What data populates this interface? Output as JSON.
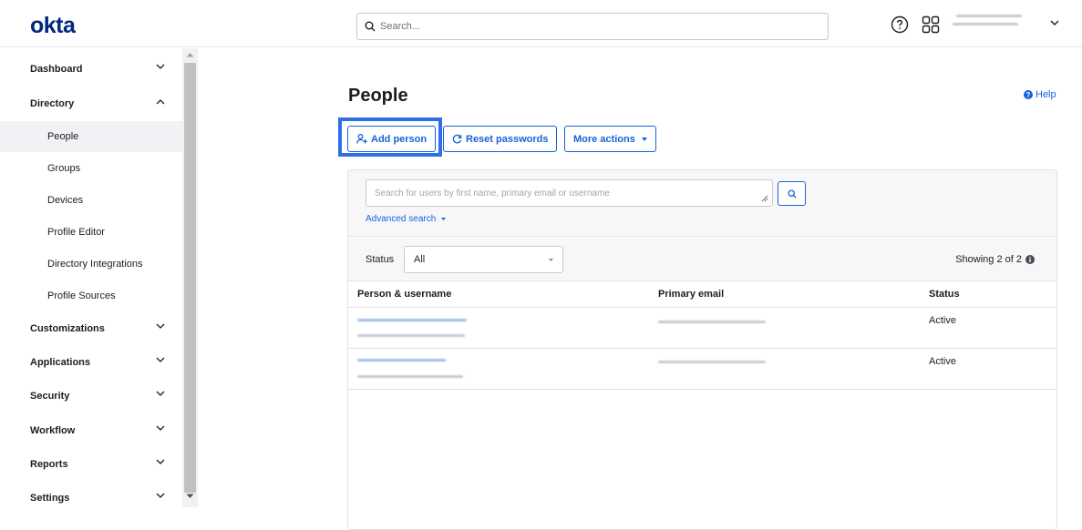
{
  "header": {
    "logo": "okta",
    "search_placeholder": "Search..."
  },
  "sidebar": {
    "items": [
      {
        "label": "Dashboard",
        "expanded": false
      },
      {
        "label": "Directory",
        "expanded": true
      },
      {
        "label": "Customizations",
        "expanded": false
      },
      {
        "label": "Applications",
        "expanded": false
      },
      {
        "label": "Security",
        "expanded": false
      },
      {
        "label": "Workflow",
        "expanded": false
      },
      {
        "label": "Reports",
        "expanded": false
      },
      {
        "label": "Settings",
        "expanded": false
      }
    ],
    "directory_sub": [
      {
        "label": "People",
        "active": true
      },
      {
        "label": "Groups"
      },
      {
        "label": "Devices"
      },
      {
        "label": "Profile Editor"
      },
      {
        "label": "Directory Integrations"
      },
      {
        "label": "Profile Sources"
      }
    ]
  },
  "main": {
    "title": "People",
    "help": "Help",
    "buttons": {
      "add_person": "Add person",
      "reset_passwords": "Reset passwords",
      "more_actions": "More actions"
    },
    "user_search_placeholder": "Search for users by first name, primary email or username",
    "advanced_search": "Advanced search",
    "status_label": "Status",
    "status_value": "All",
    "showing": "Showing 2 of 2",
    "table": {
      "columns": [
        "Person & username",
        "Primary email",
        "Status"
      ],
      "rows": [
        {
          "status": "Active"
        },
        {
          "status": "Active"
        }
      ]
    }
  },
  "colors": {
    "accent": "#1662dd",
    "logo": "#00297a",
    "focus": "#2f6fe6"
  }
}
